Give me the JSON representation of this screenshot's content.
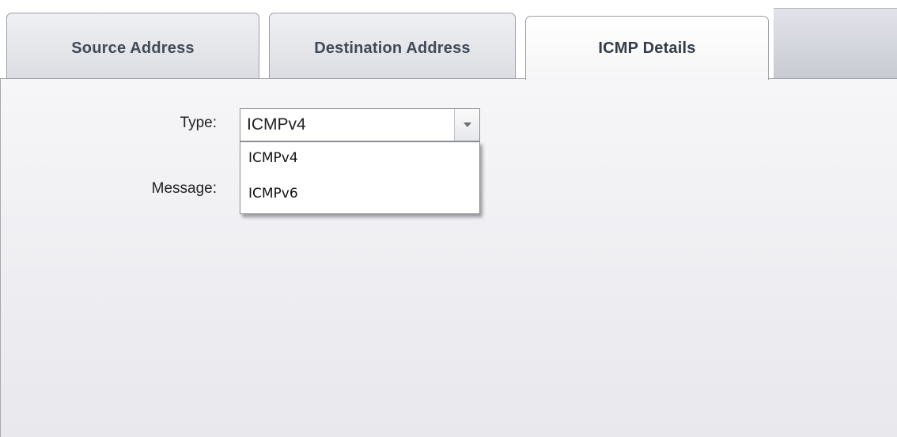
{
  "tabs": [
    {
      "label": "Source Address",
      "active": false
    },
    {
      "label": "Destination Address",
      "active": false
    },
    {
      "label": "ICMP Details",
      "active": true
    }
  ],
  "form": {
    "type_label": "Type:",
    "message_label": "Message:",
    "type_value": "ICMPv4",
    "type_options": [
      "ICMPv4",
      "ICMPv6"
    ],
    "dropdown_open": true
  },
  "icons": {
    "dropdown_arrow": "chevron-down-icon"
  },
  "colors": {
    "tab_text": "#404a56",
    "panel_bg": "#efeff2",
    "border": "#9c9ea6"
  }
}
